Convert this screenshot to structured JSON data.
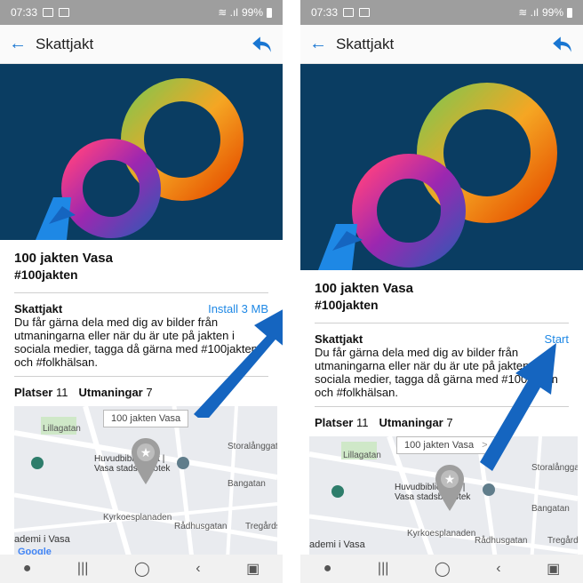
{
  "screens": [
    {
      "status": {
        "time": "07:33",
        "battery": "99%"
      },
      "appbar": {
        "title": "Skattjakt"
      },
      "hunt": {
        "title": "100 jakten Vasa",
        "tag": "#100jakten"
      },
      "section": {
        "label": "Skattjakt",
        "action": "Install 3 MB"
      },
      "description": "Du får gärna dela med dig av bilder från utmaningarna eller när du är ute på jakten i sociala medier, tagga då gärna med #100jakten och #folkhälsan.",
      "stats": {
        "places_label": "Platser",
        "places_count": "11",
        "challenges_label": "Utmaningar",
        "challenges_count": "7"
      },
      "map": {
        "callout": "100 jakten Vasa",
        "poi": "Huvudbiblioteket | Vasa stadsbibliotek",
        "labels": [
          "Lillagatan",
          "Storalånggatan",
          "Bangatan",
          "Kyrkoesplanaden",
          "Rådhusgatan",
          "Tregårdsgatan",
          "ademi i Vasa",
          "Google"
        ]
      }
    },
    {
      "status": {
        "time": "07:33",
        "battery": "99%"
      },
      "appbar": {
        "title": "Skattjakt"
      },
      "hunt": {
        "title": "100 jakten Vasa",
        "tag": "#100jakten"
      },
      "section": {
        "label": "Skattjakt",
        "action": "Start"
      },
      "description": "Du får gärna dela med dig av bilder från utmaningarna eller när du är ute på jakten i sociala medier, tagga då gärna med #100jakten och #folkhälsan.",
      "stats": {
        "places_label": "Platser",
        "places_count": "11",
        "challenges_label": "Utmaningar",
        "challenges_count": "7"
      },
      "map": {
        "callout": "100 jakten Vasa",
        "callout_chevron": ">",
        "poi": "Huvudbiblioteket | Vasa stadsbibliotek",
        "labels": [
          "Lillagatan",
          "Storalånggatan",
          "Bangatan",
          "Kyrkoesplanaden",
          "Rådhusgatan",
          "Tregårdsgatan",
          "ademi i Vasa"
        ]
      }
    }
  ],
  "icons": {
    "back": "arrow-left-icon",
    "share": "share-icon",
    "pin": "map-pin-icon",
    "poi": "library-icon",
    "pointer": "arrow-pointer-icon"
  },
  "colors": {
    "accent": "#1e88e5",
    "hero_bg": "#0a3d62",
    "arrow": "#1565c0"
  }
}
